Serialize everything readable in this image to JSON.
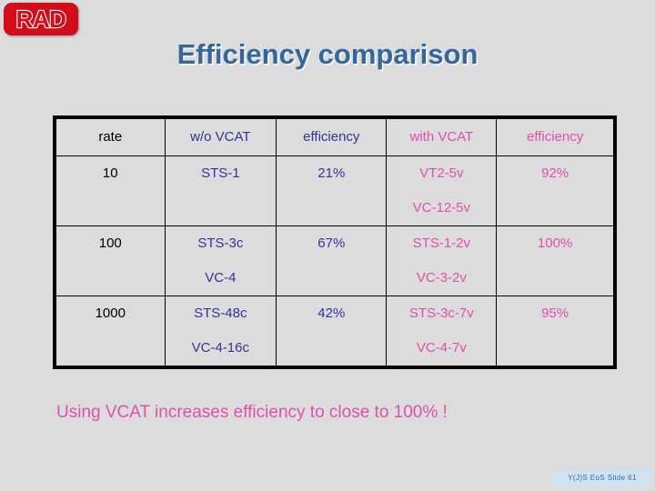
{
  "logo": {
    "text": "RAD",
    "color": "#d40c19"
  },
  "title": {
    "text": "Efficiency comparison",
    "color": "#35679a"
  },
  "colors": {
    "background": "#dcdcdc",
    "black": "#000000",
    "blue": "#333399",
    "magenta": "#e04fae",
    "footer_bg": "#cfe2f0",
    "footer_text": "#2f6ea5"
  },
  "table": {
    "headers": [
      "rate",
      "w/o VCAT",
      "efficiency",
      "with VCAT",
      "efficiency"
    ],
    "rows": [
      {
        "rate": "10",
        "wo_vcat_1": "STS-1",
        "wo_vcat_2": "",
        "efficiency_wo": "21%",
        "with_vcat_1": "VT2-5v",
        "with_vcat_2": "VC-12-5v",
        "efficiency_with": "92%"
      },
      {
        "rate": "100",
        "wo_vcat_1": "STS-3c",
        "wo_vcat_2": "VC-4",
        "efficiency_wo": "67%",
        "with_vcat_1": "STS-1-2v",
        "with_vcat_2": "VC-3-2v",
        "efficiency_with": "100%"
      },
      {
        "rate": "1000",
        "wo_vcat_1": "STS-48c",
        "wo_vcat_2": "VC-4-16c",
        "efficiency_wo": "42%",
        "with_vcat_1": "STS-3c-7v",
        "with_vcat_2": "VC-4-7v",
        "efficiency_with": "95%"
      }
    ]
  },
  "caption": {
    "text": "Using VCAT increases efficiency to close to 100% !"
  },
  "footer": {
    "text": "Y(J)S EoS   Slide 61"
  }
}
